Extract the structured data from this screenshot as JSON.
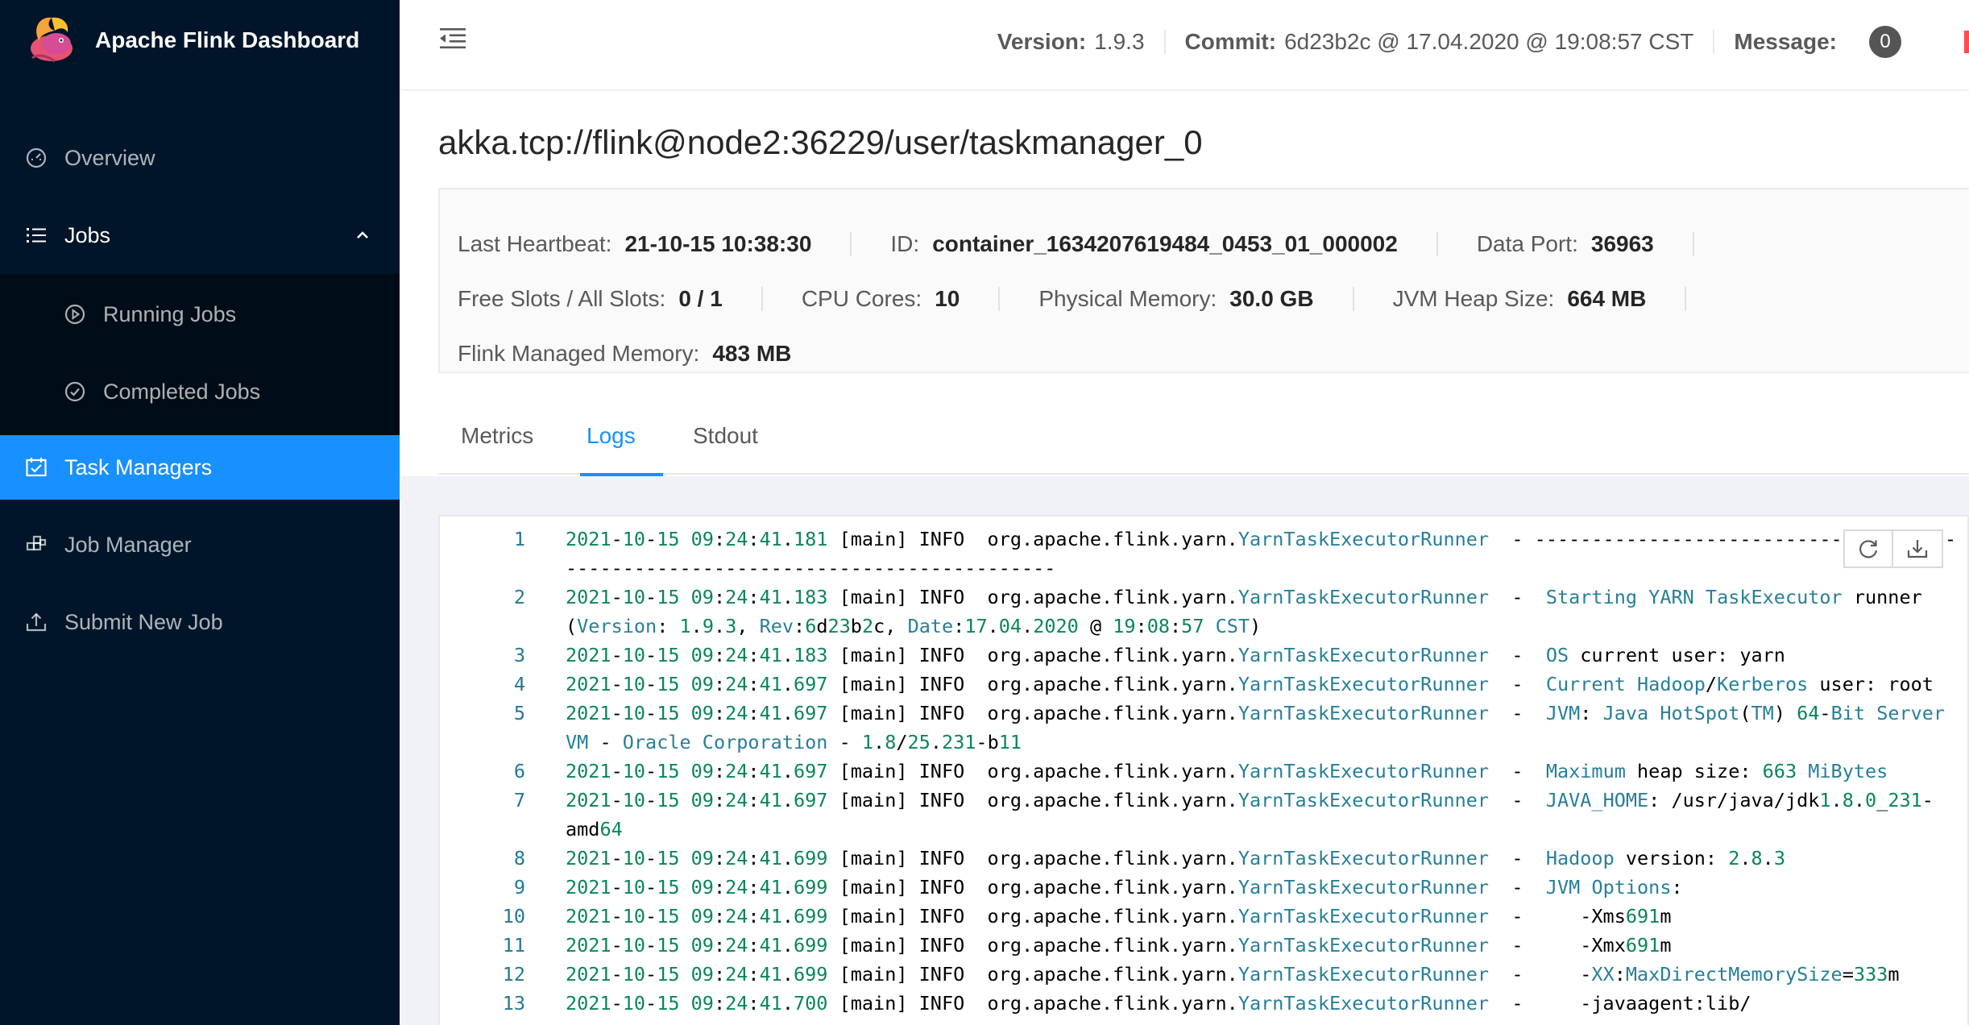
{
  "app": {
    "title": "Apache Flink Dashboard"
  },
  "sidebar": {
    "items": [
      {
        "label": "Overview",
        "icon": "dashboard-icon"
      },
      {
        "label": "Jobs",
        "icon": "list-icon"
      },
      {
        "label": "Running Jobs",
        "icon": "play-circle-icon"
      },
      {
        "label": "Completed Jobs",
        "icon": "check-circle-icon"
      },
      {
        "label": "Task Managers",
        "icon": "schedule-icon"
      },
      {
        "label": "Job Manager",
        "icon": "build-icon"
      },
      {
        "label": "Submit New Job",
        "icon": "upload-icon"
      }
    ],
    "active": "Task Managers"
  },
  "header": {
    "version_label": "Version:",
    "version_value": "1.9.3",
    "commit_label": "Commit:",
    "commit_value": "6d23b2c @ 17.04.2020 @ 19:08:57 CST",
    "message_label": "Message:",
    "message_count": "0"
  },
  "taskmanager": {
    "title": "akka.tcp://flink@node2:36229/user/taskmanager_0",
    "last_heartbeat_label": "Last Heartbeat:",
    "last_heartbeat": "21-10-15 10:38:30",
    "id_label": "ID:",
    "id": "container_1634207619484_0453_01_000002",
    "data_port_label": "Data Port:",
    "data_port": "36963",
    "slots_label": "Free Slots / All Slots:",
    "slots": "0 / 1",
    "cpu_label": "CPU Cores:",
    "cpu": "10",
    "physical_memory_label": "Physical Memory:",
    "physical_memory": "30.0 GB",
    "jvm_heap_label": "JVM Heap Size:",
    "jvm_heap": "664 MB",
    "managed_memory_label": "Flink Managed Memory:",
    "managed_memory": "483 MB"
  },
  "tabs": [
    {
      "label": "Metrics"
    },
    {
      "label": "Logs"
    },
    {
      "label": "Stdout"
    }
  ],
  "active_tab": "Logs",
  "log": {
    "tools": [
      "reload-icon",
      "download-icon"
    ],
    "lines": [
      {
        "n": "1",
        "text": "2021-10-15 09:24:41.181 [main] INFO  org.apache.flink.yarn.YarnTaskExecutorRunner  - --------------------------------------------------------------------------------"
      },
      {
        "n": "2",
        "text": "2021-10-15 09:24:41.183 [main] INFO  org.apache.flink.yarn.YarnTaskExecutorRunner  -  Starting YARN TaskExecutor runner (Version: 1.9.3, Rev:6d23b2c, Date:17.04.2020 @ 19:08:57 CST)"
      },
      {
        "n": "3",
        "text": "2021-10-15 09:24:41.183 [main] INFO  org.apache.flink.yarn.YarnTaskExecutorRunner  -  OS current user: yarn"
      },
      {
        "n": "4",
        "text": "2021-10-15 09:24:41.697 [main] INFO  org.apache.flink.yarn.YarnTaskExecutorRunner  -  Current Hadoop/Kerberos user: root"
      },
      {
        "n": "5",
        "text": "2021-10-15 09:24:41.697 [main] INFO  org.apache.flink.yarn.YarnTaskExecutorRunner  -  JVM: Java HotSpot(TM) 64-Bit Server VM - Oracle Corporation - 1.8/25.231-b11"
      },
      {
        "n": "6",
        "text": "2021-10-15 09:24:41.697 [main] INFO  org.apache.flink.yarn.YarnTaskExecutorRunner  -  Maximum heap size: 663 MiBytes"
      },
      {
        "n": "7",
        "text": "2021-10-15 09:24:41.697 [main] INFO  org.apache.flink.yarn.YarnTaskExecutorRunner  -  JAVA_HOME: /usr/java/jdk1.8.0_231-amd64"
      },
      {
        "n": "8",
        "text": "2021-10-15 09:24:41.699 [main] INFO  org.apache.flink.yarn.YarnTaskExecutorRunner  -  Hadoop version: 2.8.3"
      },
      {
        "n": "9",
        "text": "2021-10-15 09:24:41.699 [main] INFO  org.apache.flink.yarn.YarnTaskExecutorRunner  -  JVM Options:"
      },
      {
        "n": "10",
        "text": "2021-10-15 09:24:41.699 [main] INFO  org.apache.flink.yarn.YarnTaskExecutorRunner  -     -Xms691m"
      },
      {
        "n": "11",
        "text": "2021-10-15 09:24:41.699 [main] INFO  org.apache.flink.yarn.YarnTaskExecutorRunner  -     -Xmx691m"
      },
      {
        "n": "12",
        "text": "2021-10-15 09:24:41.699 [main] INFO  org.apache.flink.yarn.YarnTaskExecutorRunner  -     -XX:MaxDirectMemorySize=333m"
      },
      {
        "n": "13",
        "text": "2021-10-15 09:24:41.700 [main] INFO  org.apache.flink.yarn.YarnTaskExecutorRunner  -     -javaagent:lib/"
      }
    ]
  },
  "colors": {
    "sidebar_bg": "#001529",
    "accent": "#1890ff",
    "log_number": "#098658",
    "log_type": "#267f99",
    "line_number": "#237893"
  }
}
